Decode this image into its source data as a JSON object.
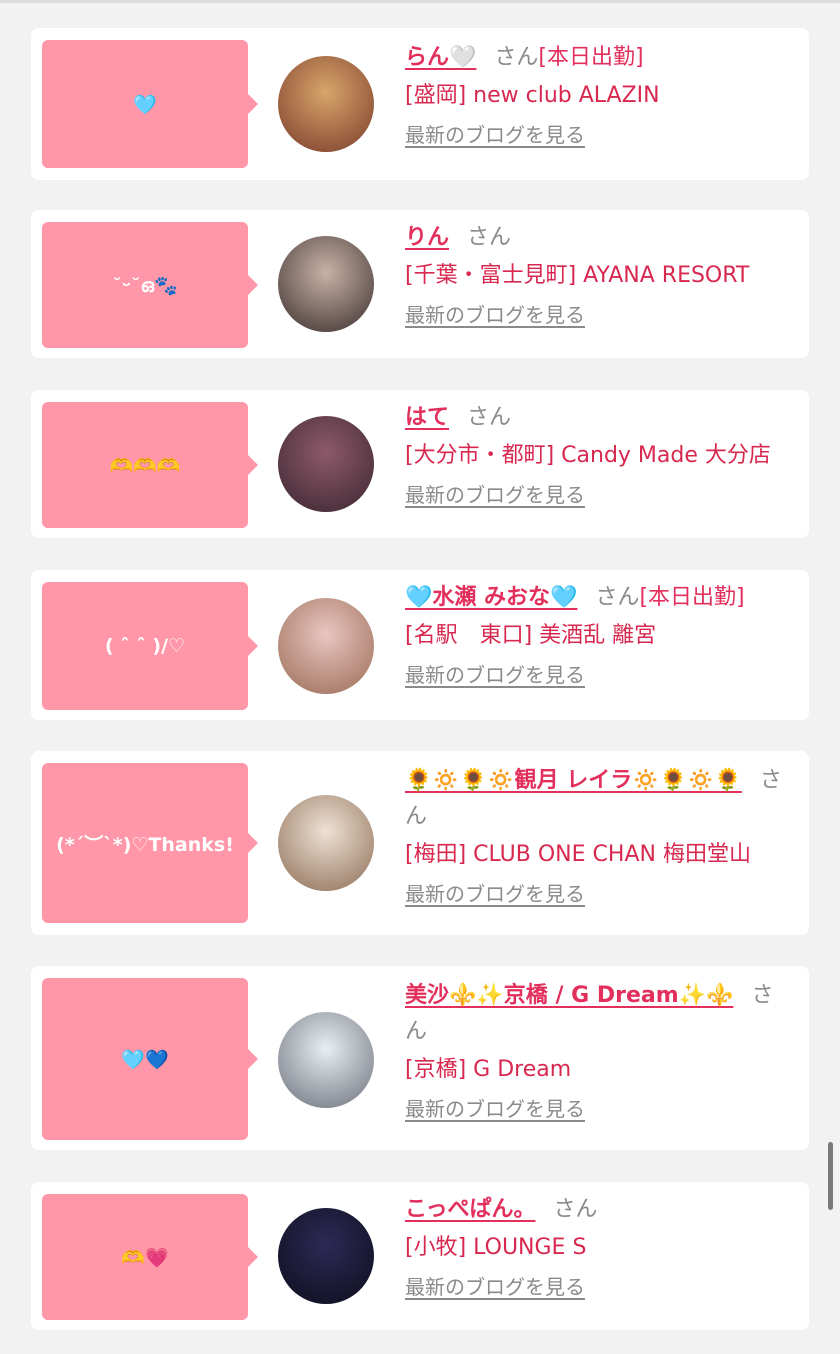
{
  "cards": [
    {
      "message": "🩵",
      "name": "らん🤍",
      "san": "さん",
      "tag": "[本日出勤]",
      "shop": "[盛岡] new club ALAZIN",
      "blog_link": "最新のブログを見る",
      "avatar": {
        "bg1": "#d8a56b",
        "bg2": "#7a3b2a"
      }
    },
    {
      "message": "˘ᵕ˘ഒ🐾",
      "name": "りん",
      "san": "さん",
      "tag": "",
      "shop": "[千葉・富士見町] AYANA RESORT",
      "blog_link": "最新のブログを見る",
      "avatar": {
        "bg1": "#c9b2a6",
        "bg2": "#3a2e2e"
      }
    },
    {
      "message": "🫶🫶🫶",
      "name": "はて",
      "san": "さん",
      "tag": "",
      "shop": "[大分市・都町] Candy Made 大分店",
      "blog_link": "最新のブログを見る",
      "avatar": {
        "bg1": "#8d5a6a",
        "bg2": "#3b2530"
      }
    },
    {
      "message": "( ˆ ˆ )/♡",
      "name": "🩵水瀬 みおな🩵",
      "san": "さん",
      "tag": "[本日出勤]",
      "shop": "[名駅　東口] 美酒乱 離宮",
      "blog_link": "最新のブログを見る",
      "avatar": {
        "bg1": "#e8c6c0",
        "bg2": "#9a6b55"
      }
    },
    {
      "message": "(*´︶`*)♡Thanks!",
      "name": "🌻🔅🌻🔅観月 レイラ🔅🌻🔅🌻",
      "san": "さん",
      "tag": "",
      "shop": "[梅田] CLUB ONE CHAN 梅田堂山",
      "blog_link": "最新のブログを見る",
      "avatar": {
        "bg1": "#efe1d4",
        "bg2": "#8c6d55"
      }
    },
    {
      "message": "🩵💙",
      "name": "美沙⚜️✨京橋 / G Dream✨⚜️",
      "san": "さん",
      "tag": "",
      "shop": "[京橋] G Dream",
      "blog_link": "最新のブログを見る",
      "avatar": {
        "bg1": "#e9eef4",
        "bg2": "#6b6f78"
      }
    },
    {
      "message": "🫶💗",
      "name": "こっぺぱん。",
      "san": "さん",
      "tag": "",
      "shop": "[小牧] LOUNGE S",
      "blog_link": "最新のブログを見る",
      "avatar": {
        "bg1": "#2c2a55",
        "bg2": "#0d0d1c"
      }
    }
  ]
}
